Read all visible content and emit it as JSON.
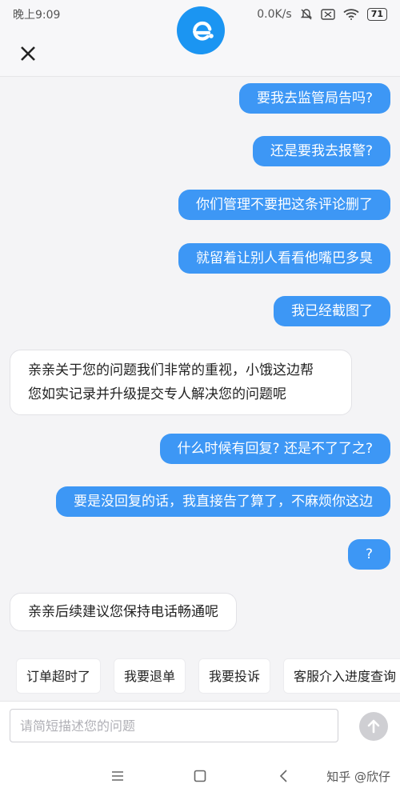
{
  "status_bar": {
    "time": "晚上9:09",
    "network_speed": "0.0K/s",
    "battery": "71"
  },
  "header": {
    "logo_icon": "eleme-logo-icon",
    "brand_color": "#1b95f2"
  },
  "messages": [
    {
      "sender": "user",
      "text": "要我去监管局告吗?"
    },
    {
      "sender": "user",
      "text": "还是要我去报警?"
    },
    {
      "sender": "user",
      "text": "你们管理不要把这条评论删了"
    },
    {
      "sender": "user",
      "text": "就留着让别人看看他嘴巴多臭"
    },
    {
      "sender": "user",
      "text": "我已经截图了"
    },
    {
      "sender": "agent",
      "lines": [
        "亲亲关于您的问题我们非常的重视，小饿这边帮",
        "您如实记录并升级提交专人解决您的问题呢"
      ]
    },
    {
      "sender": "user",
      "text": "什么时候有回复? 还是不了了之?"
    },
    {
      "sender": "user",
      "text": "要是没回复的话，我直接告了算了，不麻烦你这边"
    },
    {
      "sender": "user",
      "text": "?"
    },
    {
      "sender": "agent",
      "text": "亲亲后续建议您保持电话畅通呢"
    }
  ],
  "quick_replies": [
    "订单超时了",
    "我要退单",
    "我要投诉",
    "客服介入进度查询"
  ],
  "input": {
    "placeholder": "请简短描述您的问题",
    "value": ""
  },
  "nav": {
    "watermark": "知乎 @欣仔"
  },
  "colors": {
    "user_bubble": "#3d97f5",
    "agent_bubble": "#ffffff",
    "background": "#f4f4f6"
  }
}
